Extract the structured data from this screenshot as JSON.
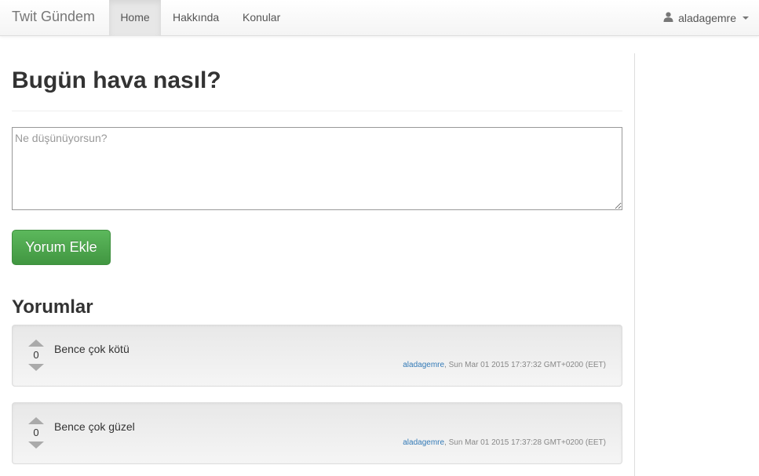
{
  "navbar": {
    "brand": "Twit Gündem",
    "items": [
      {
        "label": "Home"
      },
      {
        "label": "Hakkında"
      },
      {
        "label": "Konular"
      }
    ],
    "user": {
      "name": "aladagemre",
      "icon": "user-icon"
    }
  },
  "main": {
    "title": "Bugün hava nasıl?",
    "composer": {
      "placeholder": "Ne düşünüyorsun?",
      "value": ""
    },
    "add_button_label": "Yorum Ekle",
    "comments_heading": "Yorumlar",
    "comments": [
      {
        "votes": "0",
        "text": "Bence çok kötü",
        "author": "aladagemre",
        "timestamp": ", Sun Mar 01 2015 17:37:32 GMT+0200 (EET)"
      },
      {
        "votes": "0",
        "text": "Bence çok güzel",
        "author": "aladagemre",
        "timestamp": ", Sun Mar 01 2015 17:37:28 GMT+0200 (EET)"
      }
    ]
  },
  "colors": {
    "button_green": "#5cb85c",
    "link_blue": "#337ab7",
    "active_nav_bg": "#e7e7e7"
  }
}
